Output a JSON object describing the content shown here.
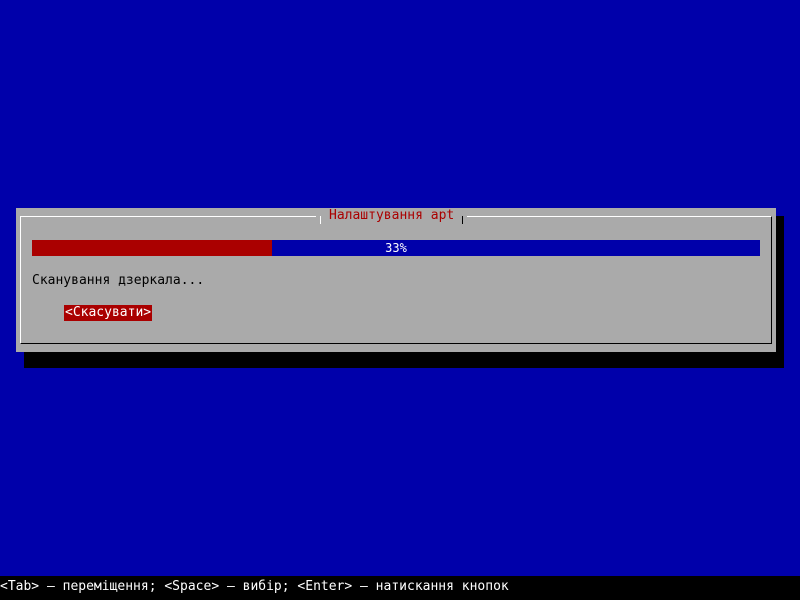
{
  "dialog": {
    "title": "Налаштування apt",
    "progress": {
      "percent_label": "33%",
      "fraction": 0.33
    },
    "status_text": "Сканування дзеркала...",
    "cancel_label": "<Скасувати>"
  },
  "help_line": "<Tab> – переміщення; <Space> – вибір; <Enter> – натискання кнопок",
  "colors": {
    "background": "#0000aa",
    "dialog": "#aaaaaa",
    "accent": "#aa0000",
    "progress_empty": "#0000aa",
    "text": "#000000",
    "help_bar": "#000000",
    "help_text": "#ffffff"
  }
}
